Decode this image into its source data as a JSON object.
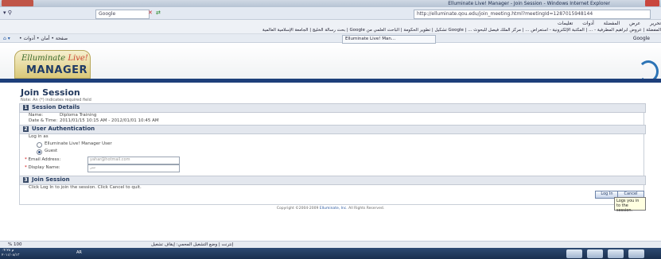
{
  "window": {
    "title": "Elluminate Live! Manager - Join Session - Windows Internet Explorer"
  },
  "browser": {
    "search_text": "Google",
    "address": "http://elluminate.qou.edu/join_meeting.html?meetingId=1287015948144",
    "menu": [
      "تحرير",
      "عرض",
      "المفضلة",
      "أدوات",
      "تعليمات"
    ],
    "favorites": "المفضلة | عروض ابراهيم المطرفية - ... | المكتبة الإلكترونية - استعراض ... | مركز الملك فيصل للبحوث ... | Google تشكيل | تطوير الحكومة | الباحث العلمي من Google | بحث رسالة الخليج | الجامعة الإسلامية العالمية",
    "tab_label": "Elluminate Live! Man...",
    "command_right": "Google",
    "command_left": "صفحة • أمان • أدوات •"
  },
  "page": {
    "logo_line1": "Elluminate",
    "logo_line1_accent": "Live!",
    "logo_line2": "MANAGER",
    "title": "Join Session",
    "required_note": "Note: An (*) indicates required field",
    "sections": [
      {
        "num": "1",
        "label": "Session Details"
      },
      {
        "num": "2",
        "label": "User Authentication"
      },
      {
        "num": "3",
        "label": "Join Session"
      }
    ],
    "details": {
      "name_label": "Name:",
      "name_value": "Diploma Training",
      "datetime_label": "Date & Time:",
      "datetime_value": "2011/01/15 10:15 AM - 2012/01/01 10:45 AM"
    },
    "auth": {
      "login_as": "Log in as",
      "option_manager": "Elluminate Live! Manager User",
      "option_guest": "Guest",
      "email_label": "Email Address:",
      "email_value": "yahar@hotmail.com",
      "display_label": "Display Name:",
      "display_value": "سر"
    },
    "join_instruction": "Click Log In to join the session. Click Cancel to quit.",
    "login_button": "Log In",
    "cancel_button": "Cancel",
    "tooltip": "Logs you in to the session.",
    "copyright_prefix": "Copyright ©2004-2009",
    "copyright_company": "Elluminate, Inc.",
    "copyright_suffix": "All Rights Reserved."
  },
  "statusbar": {
    "text": "إنترنت | وضع التشغيل المحمي: إيقاف تشغيل",
    "zoom": "% 100"
  },
  "taskbar": {
    "time": "۰۴:۲۸ م",
    "date": "۲۰۱۱/۰۸/۱۳",
    "lang": "AR"
  }
}
